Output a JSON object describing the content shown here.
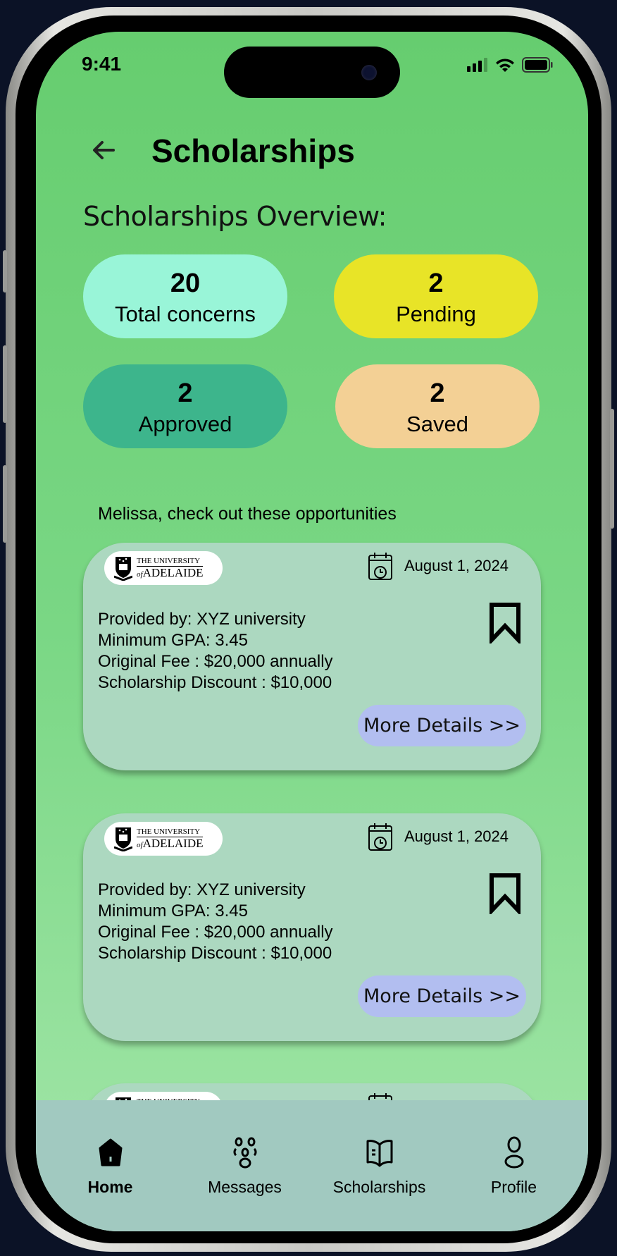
{
  "status_bar": {
    "time": "9:41"
  },
  "header": {
    "title": "Scholarships",
    "back_icon": "arrow-left-icon"
  },
  "overview": {
    "heading": "Scholarships Overview:",
    "stats": [
      {
        "value": "20",
        "label": "Total concerns",
        "color": "#99f5d8"
      },
      {
        "value": "2",
        "label": "Pending",
        "color": "#e8e427"
      },
      {
        "value": "2",
        "label": "Approved",
        "color": "#3db58c"
      },
      {
        "value": "2",
        "label": "Saved",
        "color": "#f3d095"
      }
    ]
  },
  "greeting": "Melissa, check out these opportunities",
  "cards": [
    {
      "logo": "THE UNIVERSITY of ADELAIDE",
      "date": "August 1, 2024",
      "provided_by": "Provided by: XYZ university",
      "gpa": "Minimum GPA: 3.45",
      "fee": "Original Fee : $20,000 annually",
      "discount": "Scholarship Discount : $10,000",
      "button": "More Details >>"
    },
    {
      "logo": "THE UNIVERSITY of ADELAIDE",
      "date": "August 1, 2024",
      "provided_by": "Provided by: XYZ university",
      "gpa": "Minimum GPA: 3.45",
      "fee": "Original Fee : $20,000 annually",
      "discount": "Scholarship Discount : $10,000",
      "button": "More Details >>"
    },
    {
      "logo": "THE UNIVERSITY of ADELAIDE"
    }
  ],
  "logo_text": {
    "line1": "THE UNIVERSITY",
    "of": "of",
    "line2": "ADELAIDE"
  },
  "nav": [
    {
      "label": "Home",
      "icon": "home-icon",
      "active": true
    },
    {
      "label": "Messages",
      "icon": "people-icon"
    },
    {
      "label": "Scholarships",
      "icon": "book-icon"
    },
    {
      "label": "Profile",
      "icon": "person-icon"
    }
  ]
}
